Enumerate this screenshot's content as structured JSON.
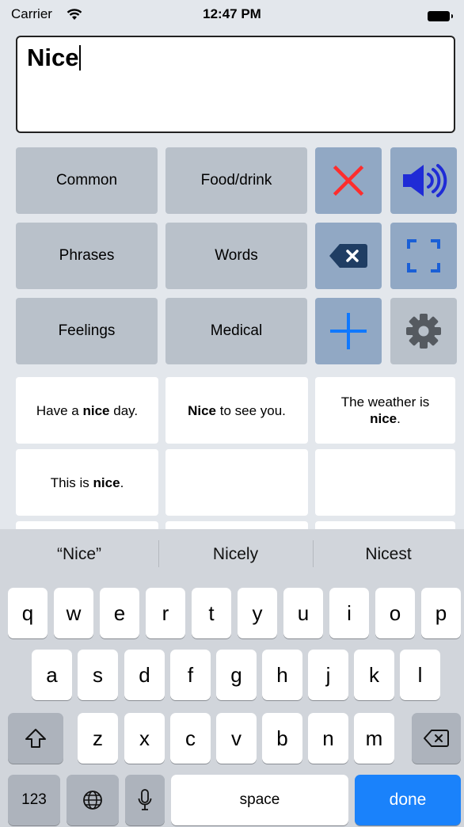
{
  "status": {
    "carrier": "Carrier",
    "time": "12:47 PM"
  },
  "text_area": {
    "value": "Nice"
  },
  "categories": [
    "Common",
    "Food/drink",
    "Phrases",
    "Words",
    "Feelings",
    "Medical"
  ],
  "tools": {
    "clear": "x-icon",
    "speak": "speaker-icon",
    "backspace": "delete-icon",
    "fullscreen": "fullscreen-icon",
    "add": "plus-icon",
    "settings": "gear-icon"
  },
  "phrases": [
    {
      "before": "Have a ",
      "bold": "nice",
      "after": " day."
    },
    {
      "before": "",
      "bold": "Nice",
      "after": " to see you."
    },
    {
      "before": "The weather is ",
      "bold": "nice",
      "after": "."
    },
    {
      "before": "This is ",
      "bold": "nice",
      "after": "."
    },
    {
      "before": "",
      "bold": "",
      "after": ""
    },
    {
      "before": "",
      "bold": "",
      "after": ""
    }
  ],
  "suggestions": [
    "“Nice”",
    "Nicely",
    "Nicest"
  ],
  "keyboard": {
    "row1": [
      "q",
      "w",
      "e",
      "r",
      "t",
      "y",
      "u",
      "i",
      "o",
      "p"
    ],
    "row2": [
      "a",
      "s",
      "d",
      "f",
      "g",
      "h",
      "j",
      "k",
      "l"
    ],
    "row3": [
      "z",
      "x",
      "c",
      "v",
      "b",
      "n",
      "m"
    ],
    "numbers_label": "123",
    "space_label": "space",
    "done_label": "done"
  },
  "colors": {
    "accent_blue": "#1a82fb",
    "clear_red": "#ff2d2d",
    "speaker_blue": "#1f2bd6",
    "add_blue": "#0f78ff"
  }
}
